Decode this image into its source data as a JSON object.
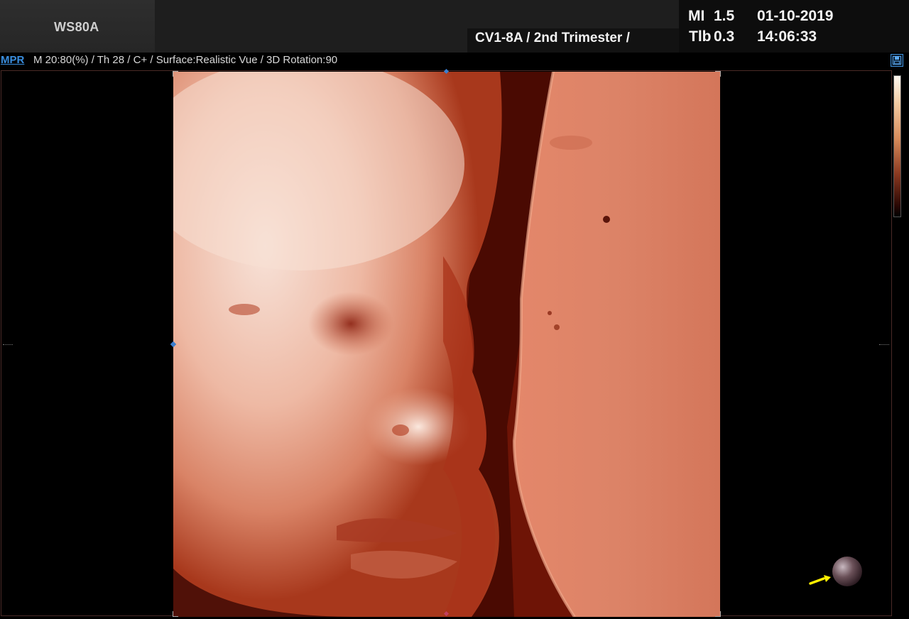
{
  "header": {
    "model": "WS80A",
    "preset": "CV1-8A / 2nd Trimester /",
    "mi_label": "MI",
    "mi_value": "1.5",
    "tib_label": "Tlb",
    "tib_value": "0.3",
    "date": "01-10-2019",
    "time": "14:06:33"
  },
  "info": {
    "mode": "MPR",
    "params": "M 20:80(%) / Th 28 / C+ / Surface:Realistic Vue / 3D Rotation:90"
  },
  "image": {
    "description_icon": "3d-render-image",
    "orientation_icon": "orientation-sphere-icon",
    "save_icon": "save-icon",
    "colors": {
      "skin_light": "#f6d9cb",
      "skin_mid": "#d97a5c",
      "shadow": "#5a0e04",
      "accent": "#3a8fe0",
      "arrow": "#ffef00"
    }
  }
}
